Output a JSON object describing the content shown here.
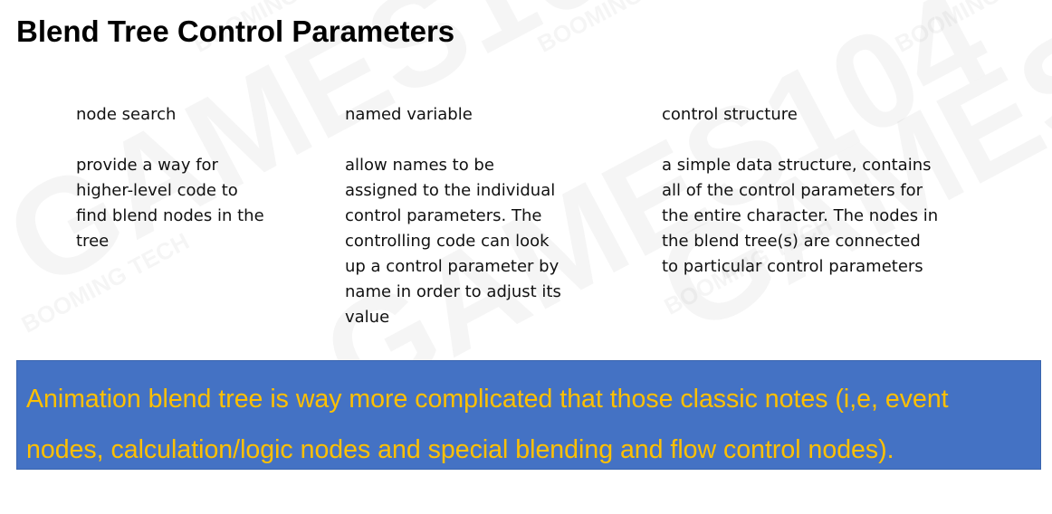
{
  "slide": {
    "title": "Blend Tree Control Parameters",
    "watermarks": [
      "GAMES104",
      "BOOMING TECH"
    ],
    "columns": [
      {
        "heading": "node search",
        "description": "provide a way for\nhigher-level code to\nfind blend nodes in the\ntree"
      },
      {
        "heading": "named variable",
        "description": "allow names to be\nassigned to the individual\ncontrol parameters. The\ncontrolling code can look\nup a control parameter by\nname in order to adjust its\nvalue"
      },
      {
        "heading": "control structure",
        "description": "a simple data structure, contains\nall of the control parameters for\nthe entire  character. The nodes in\nthe blend tree(s) are connected\nto particular control parameters"
      }
    ],
    "callout": {
      "text": "Animation blend tree is way more complicated that those classic notes (i,e, event\nnodes, calculation/logic nodes and special blending and flow control nodes).",
      "background": "#4472c4",
      "text_color": "#ffc000"
    }
  }
}
